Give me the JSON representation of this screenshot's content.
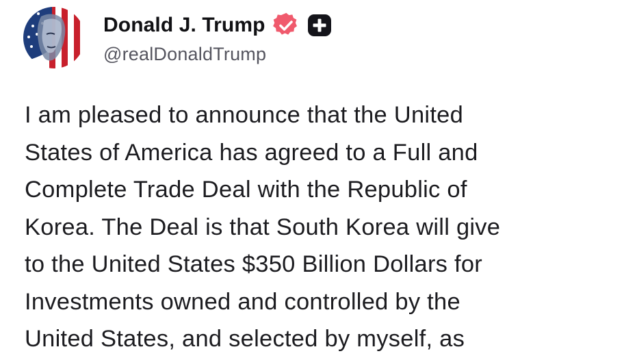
{
  "author": {
    "display_name": "Donald J. Trump",
    "handle": "@realDonaldTrump",
    "verified_icon": "verified-badge-icon",
    "plus_icon": "plus-badge-icon",
    "colors": {
      "verified": "#f05a6d",
      "plus_badge": "#14141a"
    }
  },
  "post": {
    "lines": [
      "I am pleased to announce that the United",
      "States of America has agreed to a Full and",
      "Complete Trade Deal with the Republic of",
      "Korea. The Deal is that South Korea will give",
      "to the United States $350 Billion Dollars for",
      "Investments owned and controlled by the",
      "United States, and selected by myself, as"
    ]
  }
}
